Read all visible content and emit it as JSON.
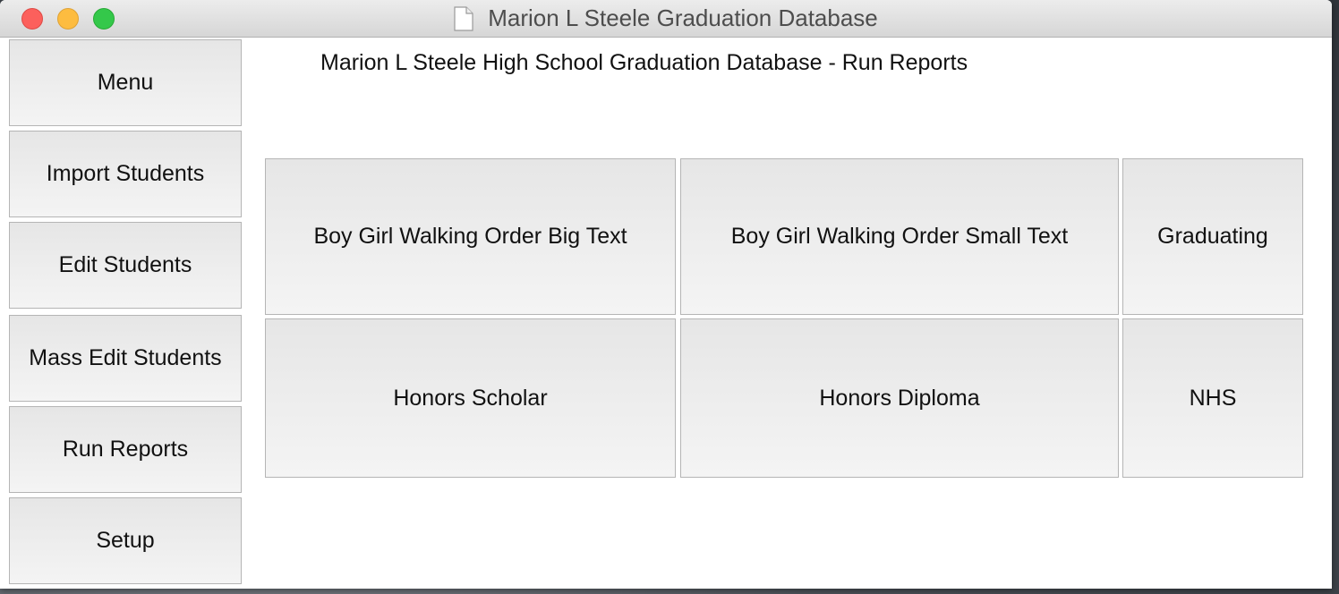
{
  "window": {
    "title": "Marion L Steele Graduation Database"
  },
  "sidebar": {
    "items": [
      {
        "label": "Menu"
      },
      {
        "label": "Import Students"
      },
      {
        "label": "Edit Students"
      },
      {
        "label": "Mass Edit Students"
      },
      {
        "label": "Run Reports"
      },
      {
        "label": "Setup"
      }
    ]
  },
  "main": {
    "heading": "Marion L Steele High School Graduation Database - Run Reports",
    "reports": [
      {
        "label": "Boy Girl Walking Order Big Text"
      },
      {
        "label": "Boy Girl Walking Order Small Text"
      },
      {
        "label": "Graduating"
      },
      {
        "label": "Honors Scholar"
      },
      {
        "label": "Honors Diploma"
      },
      {
        "label": "NHS"
      }
    ]
  },
  "icons": {
    "close": "close-icon",
    "minimize": "minimize-icon",
    "maximize": "maximize-icon",
    "document": "document-icon"
  },
  "colors": {
    "close": "#fc605c",
    "minimize": "#fdbc40",
    "maximize": "#34c84a"
  }
}
